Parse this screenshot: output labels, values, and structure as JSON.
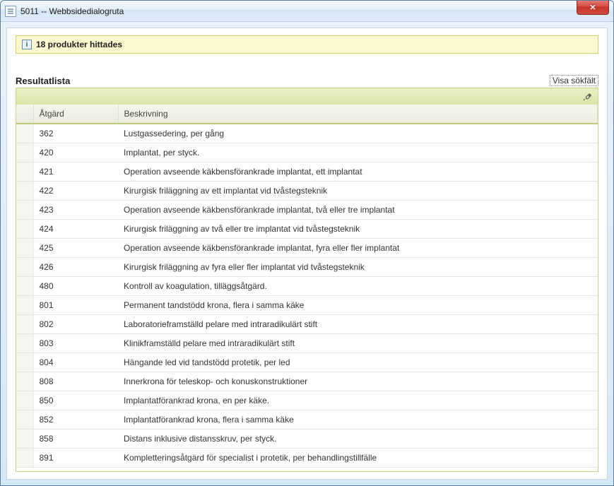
{
  "window": {
    "title": "5011 -- Webbsidedialogruta"
  },
  "info": {
    "message": "18 produkter hittades"
  },
  "result": {
    "title": "Resultatlista",
    "show_search_label": "Visa sökfält"
  },
  "columns": {
    "code": "Åtgärd",
    "desc": "Beskrivning"
  },
  "rows": [
    {
      "code": "362",
      "desc": "Lustgassedering, per gång"
    },
    {
      "code": "420",
      "desc": "Implantat, per styck."
    },
    {
      "code": "421",
      "desc": "Operation avseende käkbensförankrade implantat, ett implantat"
    },
    {
      "code": "422",
      "desc": "Kirurgisk friläggning av ett implantat vid tvåstegsteknik"
    },
    {
      "code": "423",
      "desc": "Operation avseende käkbensförankrade implantat, två eller tre implantat"
    },
    {
      "code": "424",
      "desc": "Kirurgisk friläggning av två eller tre implantat vid tvåstegsteknik"
    },
    {
      "code": "425",
      "desc": "Operation avseende käkbensförankrade implantat, fyra eller fler implantat"
    },
    {
      "code": "426",
      "desc": "Kirurgisk friläggning av fyra eller fler implantat vid tvåstegsteknik"
    },
    {
      "code": "480",
      "desc": "Kontroll av koagulation, tilläggsåtgärd."
    },
    {
      "code": "801",
      "desc": "Permanent tandstödd krona, flera i samma käke"
    },
    {
      "code": "802",
      "desc": "Laboratorieframställd pelare med intraradikulärt stift"
    },
    {
      "code": "803",
      "desc": "Klinikframställd pelare med intraradikulärt stift"
    },
    {
      "code": "804",
      "desc": "Hängande led vid tandstödd protetik, per led"
    },
    {
      "code": "808",
      "desc": "Innerkrona för teleskop- och konuskonstruktioner"
    },
    {
      "code": "850",
      "desc": "Implantatförankrad krona, en per käke."
    },
    {
      "code": "852",
      "desc": "Implantatförankrad krona, flera i samma käke"
    },
    {
      "code": "858",
      "desc": "Distans inklusive distansskruv, per styck."
    },
    {
      "code": "891",
      "desc": "Kompletteringsåtgärd för specialist i protetik, per behandlingstillfälle"
    }
  ]
}
